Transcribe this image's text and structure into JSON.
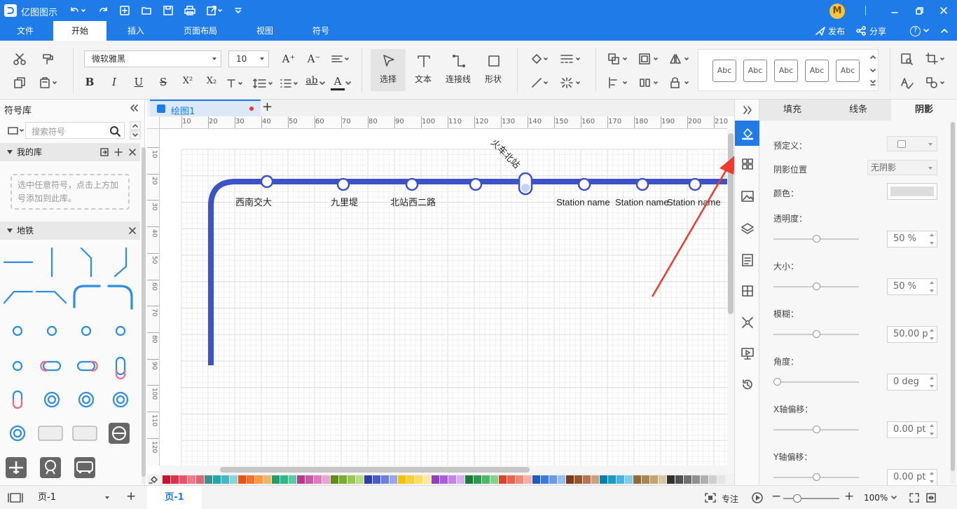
{
  "app": {
    "title": "亿图图示"
  },
  "menu": {
    "items": [
      "文件",
      "开始",
      "插入",
      "页面布局",
      "视图",
      "符号"
    ],
    "active": "开始"
  },
  "titlebar_right": {
    "publish": "发布",
    "share": "分享",
    "help": "?"
  },
  "ribbon": {
    "font_family": "微软雅黑",
    "font_size": "10",
    "select_label": "选择",
    "text_label": "文本",
    "connector_label": "连接线",
    "shape_label": "形状",
    "style_sample": "Abc",
    "bold": "B",
    "italic": "I",
    "underline": "U",
    "strike": "S",
    "sup": "X²",
    "sub": "X₂",
    "ab": "ab",
    "fontcolor": "A",
    "grow": "A⁺",
    "shrink": "A⁻"
  },
  "library": {
    "title": "符号库",
    "search_placeholder": "搜索符号",
    "my_library": "我的库",
    "my_library_hint": "选中任意符号，点击上方加号添加到此库。",
    "metro_section": "地铁"
  },
  "document": {
    "tab_name": "绘图1",
    "new_tab": "+"
  },
  "ruler": {
    "h_ticks": [
      "10",
      "20",
      "30",
      "40",
      "50",
      "60",
      "70",
      "80",
      "90",
      "100",
      "110",
      "120",
      "130",
      "140",
      "150",
      "160",
      "170",
      "180",
      "190",
      "200",
      "210"
    ],
    "v_ticks": [
      "10",
      "20",
      "30",
      "40",
      "50",
      "60",
      "70",
      "80",
      "90",
      "100",
      "110",
      "120"
    ]
  },
  "canvas": {
    "line_color": "#3f51c7",
    "stations": [
      "西南交大",
      "九里堤",
      "北站西二路",
      "火车北站",
      "Station name",
      "Station name",
      "Station name"
    ]
  },
  "right_panel": {
    "tabs": [
      "填充",
      "线条",
      "阴影"
    ],
    "active_tab": "阴影",
    "preset_label": "预定义：",
    "position_label": "阴影位置",
    "position_value": "无阴影",
    "color_label": "颜色：",
    "opacity_label": "透明度：",
    "opacity_value": "50 %",
    "opacity_level": 0.5,
    "size_label": "大小：",
    "size_value": "50 %",
    "size_level": 0.5,
    "blur_label": "模糊：",
    "blur_value": "50.00 p",
    "blur_level": 0.5,
    "angle_label": "角度：",
    "angle_value": "0 deg",
    "angle_level": 0,
    "xoffset_label": "X轴偏移：",
    "xoffset_value": "0.00 pt",
    "xoffset_level": 0.5,
    "yoffset_label": "Y轴偏移：",
    "yoffset_value": "0.00 pt",
    "yoffset_level": 0.5
  },
  "status": {
    "page_select": "页-1",
    "add_page": "+",
    "page_tab": "页-1",
    "focus": "专注",
    "zoom": "100%",
    "zoom_minus": "−",
    "zoom_plus": "+"
  },
  "colors": {
    "accent": "#1e7be8",
    "arrow": "#f03a2e",
    "metro_blue": "#3f51c7",
    "shape_blue": "#2d8de0"
  }
}
